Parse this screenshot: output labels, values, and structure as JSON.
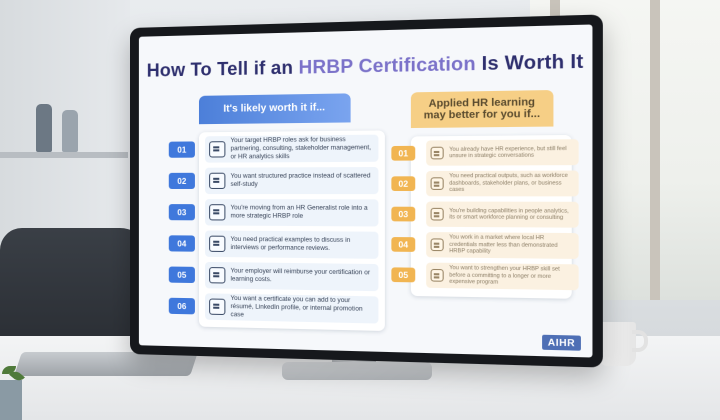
{
  "page": {
    "title_main": "How To Tell if an ",
    "title_accent": "HRBP Certification",
    "title_end": " Is Worth It",
    "brand": "AIHR"
  },
  "left": {
    "header": "It's likely worth it if...",
    "items": [
      {
        "num": "01",
        "icon": "document-icon",
        "text": "Your target HRBP roles ask for business partnering, consulting, stakeholder management, or HR analytics skills"
      },
      {
        "num": "02",
        "icon": "checklist-icon",
        "text": "You want structured practice instead of scattered self-study"
      },
      {
        "num": "03",
        "icon": "career-path-icon",
        "text": "You're moving from an HR Generalist role into a more strategic HRBP role"
      },
      {
        "num": "04",
        "icon": "case-study-icon",
        "text": "You need practical examples to discuss in interviews or performance reviews."
      },
      {
        "num": "05",
        "icon": "reimbursement-icon",
        "text": "Your employer will reimburse your certification or learning costs."
      },
      {
        "num": "06",
        "icon": "certificate-icon",
        "text": "You want a certificate you can add to your résumé, LinkedIn profile, or internal promotion case"
      }
    ]
  },
  "right": {
    "header": "Applied HR learning may better for you if...",
    "items": [
      {
        "num": "01",
        "icon": "chat-icon",
        "text": "You already have HR experience, but still feel unsure in strategic conversations"
      },
      {
        "num": "02",
        "icon": "document-icon",
        "text": "You need practical outputs, such as workforce dashboards, stakeholder plans, or business cases"
      },
      {
        "num": "03",
        "icon": "analytics-icon",
        "text": "You're building capabilities in people analytics, its or smart workforce planning or consulting"
      },
      {
        "num": "04",
        "icon": "team-icon",
        "text": "You work in a market where local HR credentials matter less than demonstrated HRBP capability"
      },
      {
        "num": "05",
        "icon": "growth-icon",
        "text": "You want to strengthen your HRBP skill set before a committing to a longer or more expensive program"
      }
    ]
  },
  "colors": {
    "title": "#2e2f6e",
    "title_accent": "#7b72c9",
    "left_accent": "#3f78dc",
    "right_accent": "#f1b552"
  }
}
